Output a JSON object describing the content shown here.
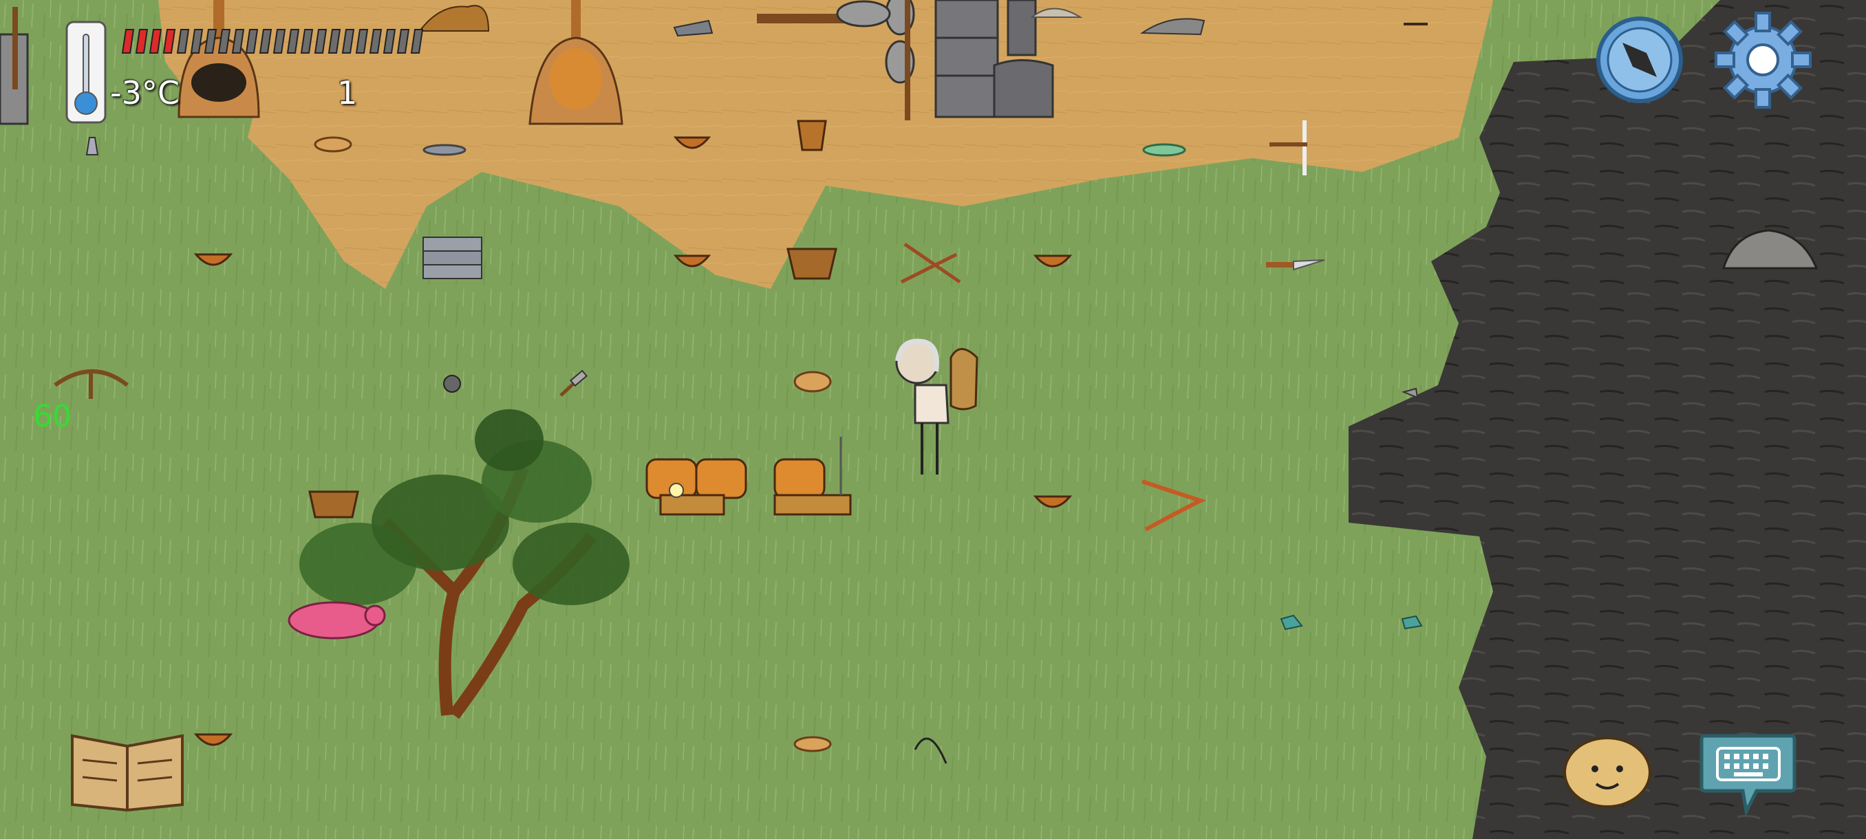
{
  "hud": {
    "temperature": "-3°C",
    "counter": "1",
    "fps": "60",
    "food_meter": {
      "filled": 4,
      "total": 22
    }
  },
  "colors": {
    "grass": "#7fa25a",
    "dirt": "#d3a45e",
    "rock": "#3a3836",
    "food_filled": "#e02a2a",
    "food_empty": "#6d6d6d",
    "fps_text": "#33dd33",
    "compass": "#6aa6dc",
    "settings": "#7aaee2"
  },
  "icons": {
    "thermometer": "thermometer-icon",
    "compass": "compass-icon",
    "settings": "gear-icon",
    "tech_book": "book-icon",
    "emote": "smiley-face-icon",
    "chat": "keyboard-icon"
  }
}
